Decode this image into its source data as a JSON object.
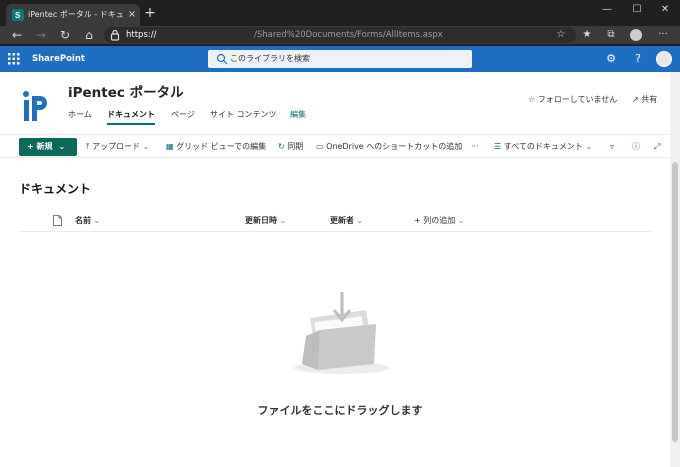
{
  "browser": {
    "tab_title": "iPentec ポータル - ドキュメント - すべ",
    "tab_close": "×",
    "new_tab": "+",
    "window_minimize": "—",
    "window_maximize": "☐",
    "window_close": "✕",
    "url_scheme": "https://",
    "url_path": "/Shared%20Documents/Forms/AllItems.aspx"
  },
  "suite": {
    "brand": "SharePoint",
    "search_placeholder": "このライブラリを検索",
    "settings_glyph": "⚙",
    "help_glyph": "?"
  },
  "site": {
    "title": "iPentec ポータル",
    "nav": [
      {
        "label": "ホーム"
      },
      {
        "label": "ドキュメント"
      },
      {
        "label": "ページ"
      },
      {
        "label": "サイト コンテンツ"
      },
      {
        "label": "編集"
      }
    ],
    "follow": "フォローしていません",
    "share": "共有"
  },
  "commands": {
    "new": "新規",
    "upload": "アップロード",
    "grid_edit": "グリッド ビューでの編集",
    "sync": "同期",
    "onedrive_shortcut": "OneDrive へのショートカットの追加",
    "more": "···",
    "view": "すべてのドキュメント"
  },
  "library": {
    "title": "ドキュメント",
    "columns": [
      "名前",
      "更新日時",
      "更新者",
      "+ 列の追加"
    ],
    "empty_message": "ファイルをここにドラッグします"
  },
  "colors": {
    "suite_bar": "#1e6fc2",
    "accent": "#0b6a77",
    "new_button": "#0b6a5c"
  }
}
